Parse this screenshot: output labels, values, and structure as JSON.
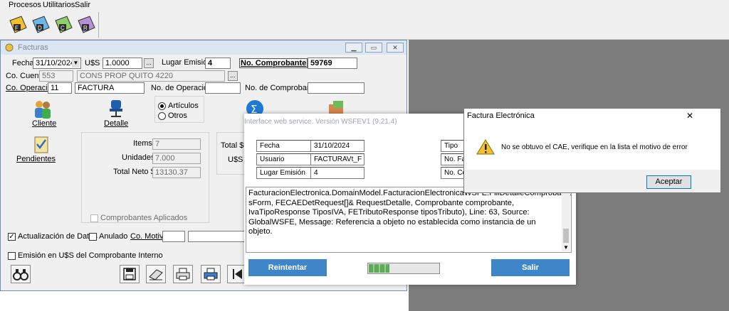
{
  "menu": {
    "procesos": "Procesos",
    "utilitarios": "Utilitarios",
    "salir": "Salir"
  },
  "toolbar": {
    "icons": [
      "factura-tool-icon",
      "nota-tool-icon",
      "credito-tool-icon",
      "debito-tool-icon"
    ]
  },
  "facturas": {
    "title": "Facturas",
    "fecha_label": "Fecha",
    "fecha_value": "31/10/2024",
    "moneda_label": "U$S",
    "moneda_value": "1.0000",
    "lookup_btn": "...",
    "lugar_emision_label": "Lugar Emisión",
    "lugar_emision_value": "4",
    "no_comprobante_label": "No. Comprobante",
    "no_comprobante_value": "59769",
    "co_cuenta_label": "Co. Cuenta",
    "co_cuenta_value": "553",
    "cuenta_nombre": "CONS PROP QUITO 4220",
    "co_operacion_label": "Co. Operación",
    "co_operacion_value": "11",
    "operacion_nombre": "FACTURA",
    "no_operacion_label": "No. de Operación",
    "no_operacion_value": "",
    "no_de_comprobante_label": "No. de Comprobante",
    "no_de_comprobante_value": "",
    "cliente_label": "Cliente",
    "detalle_label": "Detalle",
    "articulos_label": "Artículos",
    "otros_label": "Otros",
    "pendientes_label": "Pendientes",
    "items_label": "Items",
    "items_value": "7",
    "unidades_label": "Unidades",
    "unidades_value": "7.000",
    "total_neto_label": "Total Neto $",
    "total_neto_value": "13130.37",
    "comprobantes_aplicados_label": "Comprobantes Aplicados",
    "total_label": "Total $",
    "uss_label": "U$S",
    "actualizacion_label": "Actualización de Datos",
    "anulado_label": "Anulado",
    "co_motivo_label": "Co. Motivo",
    "emision_uss_label": "Emisión en U$S del Comprobante Interno"
  },
  "webservice": {
    "title": "Interface web service. Versión WSFEV1 (9.21.4)",
    "fecha_label": "Fecha",
    "fecha_value": "31/10/2024",
    "usuario_label": "Usuario",
    "usuario_value": "FACTURAVt_F",
    "lugar_label": "Lugar Emisión",
    "lugar_value": "4",
    "tipo_label": "Tipo",
    "nofa_label": "No. Fa",
    "noco_label": "No. Co",
    "message": "FacturacionElectronica.DomainModel.FacturacionElectronicaWSFE.FillDetalleComprobante(ListBoxItemAdd sForm, FECAEDetRequest[]& RequestDetalle, Comprobante comprobante, IvaTipoResponse TiposIVA, FETributoResponse tiposTributo), Line: 63, Source: GlobalWSFE, Message: Referencia a objeto no establecida como instancia de un objeto.",
    "reintentar": "Reintentar",
    "salir": "Salir",
    "progress": 0.3
  },
  "alert": {
    "title": "Factura Electrónica",
    "close": "✕",
    "message": "No se obtuvo el CAE, verifique en la lista el motivo de error",
    "ok": "Aceptar"
  }
}
